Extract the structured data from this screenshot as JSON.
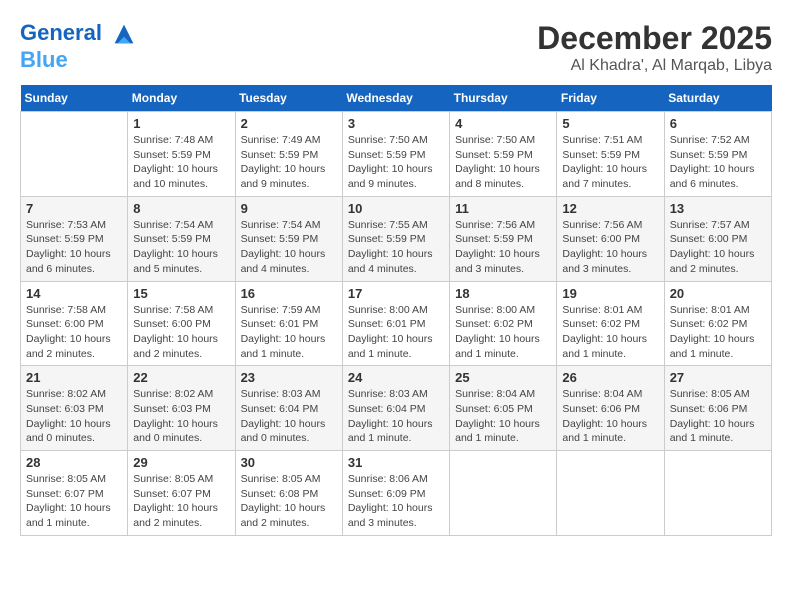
{
  "header": {
    "logo_line1": "General",
    "logo_line2": "Blue",
    "month": "December 2025",
    "location": "Al Khadra', Al Marqab, Libya"
  },
  "days_of_week": [
    "Sunday",
    "Monday",
    "Tuesday",
    "Wednesday",
    "Thursday",
    "Friday",
    "Saturday"
  ],
  "weeks": [
    [
      {
        "day": "",
        "info": ""
      },
      {
        "day": "1",
        "info": "Sunrise: 7:48 AM\nSunset: 5:59 PM\nDaylight: 10 hours\nand 10 minutes."
      },
      {
        "day": "2",
        "info": "Sunrise: 7:49 AM\nSunset: 5:59 PM\nDaylight: 10 hours\nand 9 minutes."
      },
      {
        "day": "3",
        "info": "Sunrise: 7:50 AM\nSunset: 5:59 PM\nDaylight: 10 hours\nand 9 minutes."
      },
      {
        "day": "4",
        "info": "Sunrise: 7:50 AM\nSunset: 5:59 PM\nDaylight: 10 hours\nand 8 minutes."
      },
      {
        "day": "5",
        "info": "Sunrise: 7:51 AM\nSunset: 5:59 PM\nDaylight: 10 hours\nand 7 minutes."
      },
      {
        "day": "6",
        "info": "Sunrise: 7:52 AM\nSunset: 5:59 PM\nDaylight: 10 hours\nand 6 minutes."
      }
    ],
    [
      {
        "day": "7",
        "info": "Sunrise: 7:53 AM\nSunset: 5:59 PM\nDaylight: 10 hours\nand 6 minutes."
      },
      {
        "day": "8",
        "info": "Sunrise: 7:54 AM\nSunset: 5:59 PM\nDaylight: 10 hours\nand 5 minutes."
      },
      {
        "day": "9",
        "info": "Sunrise: 7:54 AM\nSunset: 5:59 PM\nDaylight: 10 hours\nand 4 minutes."
      },
      {
        "day": "10",
        "info": "Sunrise: 7:55 AM\nSunset: 5:59 PM\nDaylight: 10 hours\nand 4 minutes."
      },
      {
        "day": "11",
        "info": "Sunrise: 7:56 AM\nSunset: 5:59 PM\nDaylight: 10 hours\nand 3 minutes."
      },
      {
        "day": "12",
        "info": "Sunrise: 7:56 AM\nSunset: 6:00 PM\nDaylight: 10 hours\nand 3 minutes."
      },
      {
        "day": "13",
        "info": "Sunrise: 7:57 AM\nSunset: 6:00 PM\nDaylight: 10 hours\nand 2 minutes."
      }
    ],
    [
      {
        "day": "14",
        "info": "Sunrise: 7:58 AM\nSunset: 6:00 PM\nDaylight: 10 hours\nand 2 minutes."
      },
      {
        "day": "15",
        "info": "Sunrise: 7:58 AM\nSunset: 6:00 PM\nDaylight: 10 hours\nand 2 minutes."
      },
      {
        "day": "16",
        "info": "Sunrise: 7:59 AM\nSunset: 6:01 PM\nDaylight: 10 hours\nand 1 minute."
      },
      {
        "day": "17",
        "info": "Sunrise: 8:00 AM\nSunset: 6:01 PM\nDaylight: 10 hours\nand 1 minute."
      },
      {
        "day": "18",
        "info": "Sunrise: 8:00 AM\nSunset: 6:02 PM\nDaylight: 10 hours\nand 1 minute."
      },
      {
        "day": "19",
        "info": "Sunrise: 8:01 AM\nSunset: 6:02 PM\nDaylight: 10 hours\nand 1 minute."
      },
      {
        "day": "20",
        "info": "Sunrise: 8:01 AM\nSunset: 6:02 PM\nDaylight: 10 hours\nand 1 minute."
      }
    ],
    [
      {
        "day": "21",
        "info": "Sunrise: 8:02 AM\nSunset: 6:03 PM\nDaylight: 10 hours\nand 0 minutes."
      },
      {
        "day": "22",
        "info": "Sunrise: 8:02 AM\nSunset: 6:03 PM\nDaylight: 10 hours\nand 0 minutes."
      },
      {
        "day": "23",
        "info": "Sunrise: 8:03 AM\nSunset: 6:04 PM\nDaylight: 10 hours\nand 0 minutes."
      },
      {
        "day": "24",
        "info": "Sunrise: 8:03 AM\nSunset: 6:04 PM\nDaylight: 10 hours\nand 1 minute."
      },
      {
        "day": "25",
        "info": "Sunrise: 8:04 AM\nSunset: 6:05 PM\nDaylight: 10 hours\nand 1 minute."
      },
      {
        "day": "26",
        "info": "Sunrise: 8:04 AM\nSunset: 6:06 PM\nDaylight: 10 hours\nand 1 minute."
      },
      {
        "day": "27",
        "info": "Sunrise: 8:05 AM\nSunset: 6:06 PM\nDaylight: 10 hours\nand 1 minute."
      }
    ],
    [
      {
        "day": "28",
        "info": "Sunrise: 8:05 AM\nSunset: 6:07 PM\nDaylight: 10 hours\nand 1 minute."
      },
      {
        "day": "29",
        "info": "Sunrise: 8:05 AM\nSunset: 6:07 PM\nDaylight: 10 hours\nand 2 minutes."
      },
      {
        "day": "30",
        "info": "Sunrise: 8:05 AM\nSunset: 6:08 PM\nDaylight: 10 hours\nand 2 minutes."
      },
      {
        "day": "31",
        "info": "Sunrise: 8:06 AM\nSunset: 6:09 PM\nDaylight: 10 hours\nand 3 minutes."
      },
      {
        "day": "",
        "info": ""
      },
      {
        "day": "",
        "info": ""
      },
      {
        "day": "",
        "info": ""
      }
    ]
  ]
}
